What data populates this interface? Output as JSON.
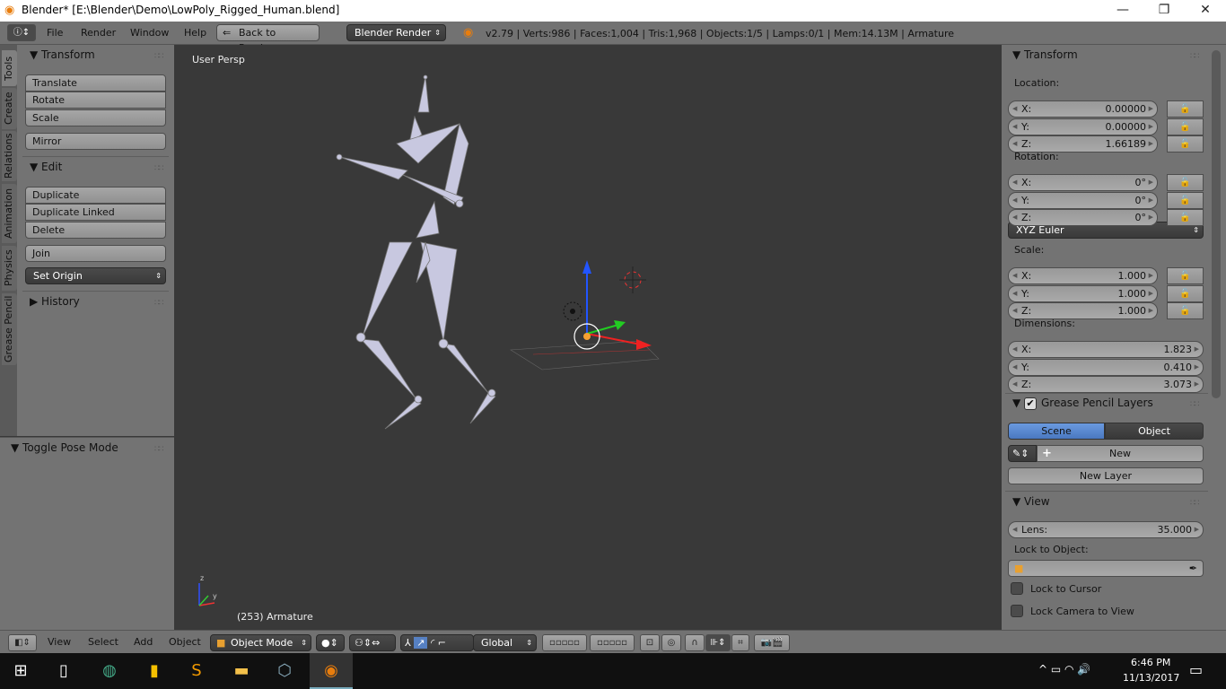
{
  "window": {
    "title": "Blender* [E:\\Blender\\Demo\\LowPoly_Rigged_Human.blend]",
    "minimize": "—",
    "maximize": "❐",
    "close": "✕"
  },
  "topbar": {
    "menus": [
      "File",
      "Render",
      "Window",
      "Help"
    ],
    "back_button": "Back to Previous",
    "render_engine": "Blender Render",
    "stats": "v2.79 | Verts:986 | Faces:1,004 | Tris:1,968 | Objects:1/5 | Lamps:0/1 | Mem:14.13M | Armature"
  },
  "left_tabs": [
    "Tools",
    "Create",
    "Relations",
    "Animation",
    "Physics",
    "Grease Pencil"
  ],
  "tool_shelf": {
    "transform": {
      "title": "Transform",
      "buttons": [
        "Translate",
        "Rotate",
        "Scale",
        "Mirror"
      ]
    },
    "edit": {
      "title": "Edit",
      "buttons": [
        "Duplicate",
        "Duplicate Linked",
        "Delete",
        "Join"
      ],
      "set_origin": "Set Origin"
    },
    "history": {
      "title": "History"
    }
  },
  "operator_panel": {
    "title": "Toggle Pose Mode"
  },
  "viewport": {
    "view_label": "User Persp",
    "object_label": "(253) Armature",
    "axis_x": "x",
    "axis_y": "y",
    "axis_z": "z"
  },
  "properties": {
    "transform": {
      "title": "Transform",
      "location_label": "Location:",
      "location": [
        {
          "k": "X:",
          "v": "0.00000"
        },
        {
          "k": "Y:",
          "v": "0.00000"
        },
        {
          "k": "Z:",
          "v": "1.66189"
        }
      ],
      "rotation_label": "Rotation:",
      "rotation": [
        {
          "k": "X:",
          "v": "0°"
        },
        {
          "k": "Y:",
          "v": "0°"
        },
        {
          "k": "Z:",
          "v": "0°"
        }
      ],
      "rotation_mode": "XYZ Euler",
      "scale_label": "Scale:",
      "scale": [
        {
          "k": "X:",
          "v": "1.000"
        },
        {
          "k": "Y:",
          "v": "1.000"
        },
        {
          "k": "Z:",
          "v": "1.000"
        }
      ],
      "dimensions_label": "Dimensions:",
      "dimensions": [
        {
          "k": "X:",
          "v": "1.823"
        },
        {
          "k": "Y:",
          "v": "0.410"
        },
        {
          "k": "Z:",
          "v": "3.073"
        }
      ]
    },
    "grease_pencil": {
      "title": "Grease Pencil Layers",
      "enabled": true,
      "scene": "Scene",
      "object": "Object",
      "new": "New",
      "new_layer": "New Layer",
      "active_source": "Scene"
    },
    "view": {
      "title": "View",
      "lens_label": "Lens:",
      "lens_value": "35.000",
      "lock_object_label": "Lock to Object:",
      "lock_cursor": "Lock to Cursor",
      "lock_camera": "Lock Camera to View",
      "lock_cursor_checked": false,
      "lock_camera_checked": false
    }
  },
  "bottombar": {
    "menus": [
      "View",
      "Select",
      "Add",
      "Object"
    ],
    "mode": "Object Mode",
    "orientation": "Global"
  },
  "taskbar": {
    "time": "6:46 PM",
    "date": "11/13/2017"
  },
  "colors": {
    "accent": "#5680c2",
    "viewport_bg": "#393939",
    "panel_bg": "#737373",
    "blender_orange": "#e87d0d"
  }
}
